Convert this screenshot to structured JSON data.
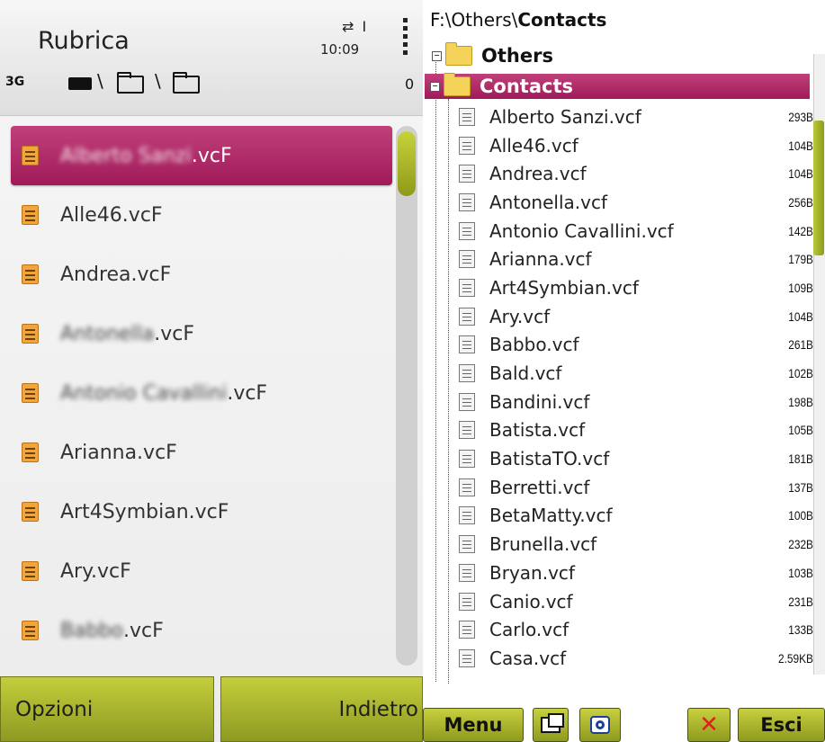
{
  "left_app": {
    "title": "Rubrica",
    "clock": "10:09",
    "network": "3G",
    "status_glyphs": "⇄ I",
    "zero_mark": "0",
    "items": [
      {
        "blurred": "Alberto Sanzi",
        "suffix": ".vcF"
      },
      {
        "blurred": "",
        "suffix": "Alle46.vcF"
      },
      {
        "blurred": "",
        "suffix": "Andrea.vcF"
      },
      {
        "blurred": "Antonella",
        "suffix": ".vcF"
      },
      {
        "blurred": "Antonio Cavallini",
        "suffix": ".vcF"
      },
      {
        "blurred": "",
        "suffix": "Arianna.vcF"
      },
      {
        "blurred": "",
        "suffix": "Art4Symbian.vcF"
      },
      {
        "blurred": "",
        "suffix": "Ary.vcF"
      },
      {
        "blurred": "Babbo",
        "suffix": ".vcF"
      }
    ],
    "softkeys": {
      "left": "Opzioni",
      "right": "Indietro"
    }
  },
  "file_manager": {
    "path_prefix": "F:\\Others\\",
    "path_current": "Contacts",
    "tree": {
      "parent": "Others",
      "current": "Contacts"
    },
    "files": [
      {
        "name": "Alberto Sanzi.vcf",
        "size": "293B"
      },
      {
        "name": "Alle46.vcf",
        "size": "104B"
      },
      {
        "name": "Andrea.vcf",
        "size": "104B"
      },
      {
        "name": "Antonella.vcf",
        "size": "256B"
      },
      {
        "name": "Antonio Cavallini.vcf",
        "size": "142B"
      },
      {
        "name": "Arianna.vcf",
        "size": "179B"
      },
      {
        "name": "Art4Symbian.vcf",
        "size": "109B"
      },
      {
        "name": "Ary.vcf",
        "size": "104B"
      },
      {
        "name": "Babbo.vcf",
        "size": "261B"
      },
      {
        "name": "Bald.vcf",
        "size": "102B"
      },
      {
        "name": "Bandini.vcf",
        "size": "198B"
      },
      {
        "name": "Batista.vcf",
        "size": "105B"
      },
      {
        "name": "BatistaTO.vcf",
        "size": "181B"
      },
      {
        "name": "Berretti.vcf",
        "size": "137B"
      },
      {
        "name": "BetaMatty.vcf",
        "size": "100B"
      },
      {
        "name": "Brunella.vcf",
        "size": "232B"
      },
      {
        "name": "Bryan.vcf",
        "size": "103B"
      },
      {
        "name": "Canio.vcf",
        "size": "231B"
      },
      {
        "name": "Carlo.vcf",
        "size": "133B"
      },
      {
        "name": "Casa.vcf",
        "size": "2.59KB"
      }
    ],
    "toolbar": {
      "menu": "Menu",
      "close_glyph": "✕",
      "exit": "Esci"
    }
  }
}
